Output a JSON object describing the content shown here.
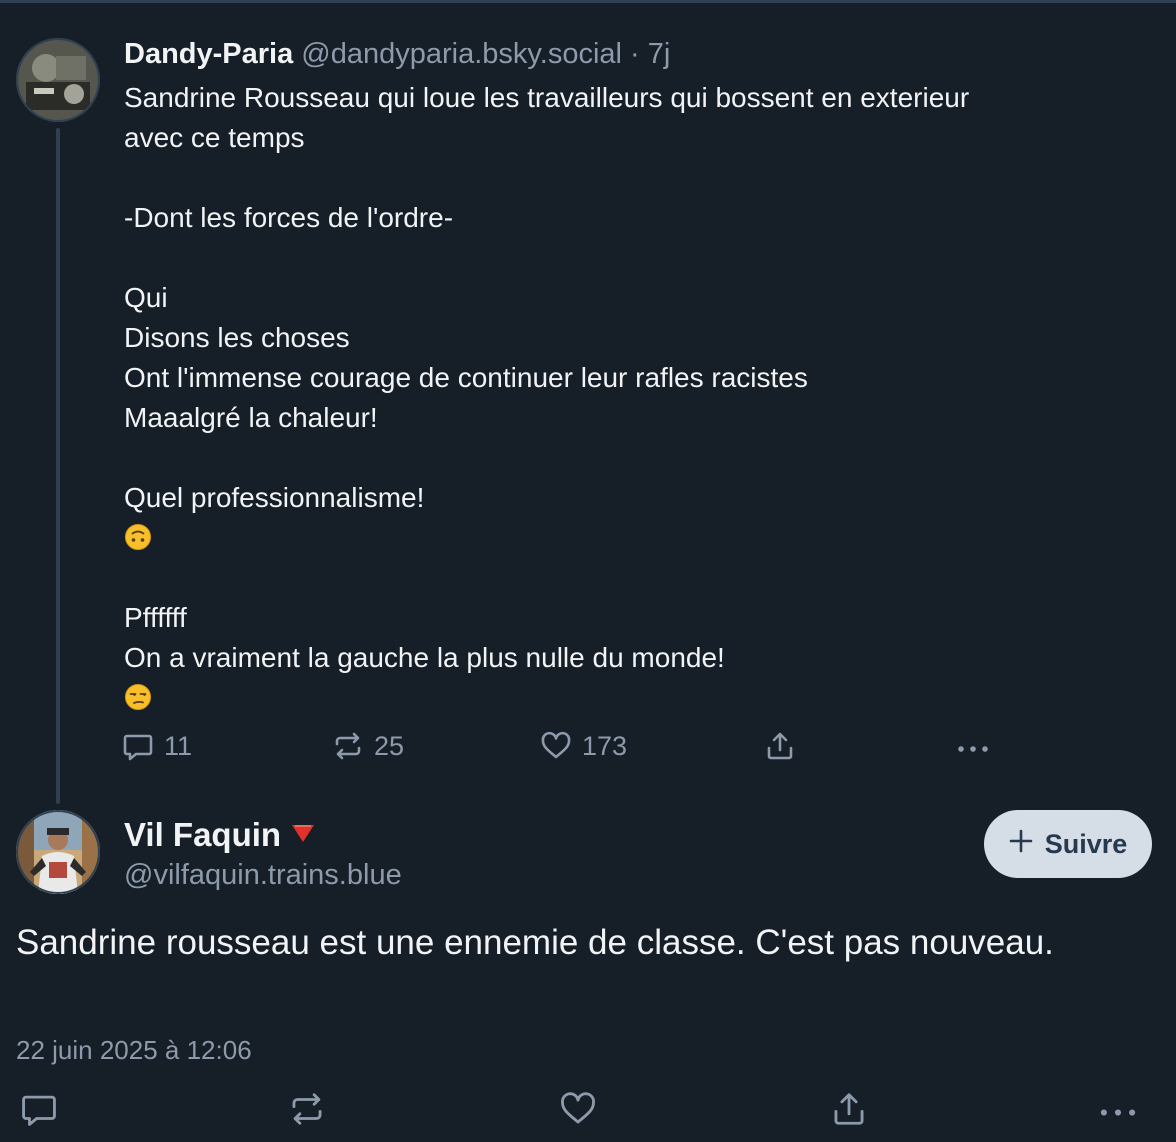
{
  "parent_post": {
    "author_name": "Dandy-Paria",
    "author_handle": "@dandyparia.bsky.social",
    "age": "· 7j",
    "text": "Sandrine Rousseau qui loue les travailleurs qui bossent en exterieur\navec ce temps\n\n-Dont les forces de l'ordre-\n\nQui\nDisons les choses\nOnt l'immense courage de continuer leur rafles racistes\nMaaalgré la chaleur!\n\nQuel professionnalisme!",
    "emoji_1": "upside-down-face-emoji",
    "text_2": "Pffffff\nOn a vraiment la gauche la plus nulle du monde!",
    "emoji_2": "unamused-face-emoji",
    "reply_count": "11",
    "repost_count": "25",
    "like_count": "173"
  },
  "main_post": {
    "author_name": "Vil Faquin",
    "author_badge": "red-triangle-down",
    "author_handle": "@vilfaquin.trains.blue",
    "follow_label": "Suivre",
    "text": "Sandrine rousseau est une ennemie de classe. C'est pas nouveau.",
    "timestamp": "22 juin 2025 à 12:06"
  },
  "icons": {
    "reply": "speech-bubble-icon",
    "repost": "repost-arrows-icon",
    "like": "heart-icon",
    "share": "share-upload-icon",
    "more": "more-dots-icon",
    "follow": "plus-icon"
  },
  "colors": {
    "background": "#161e27",
    "text": "#f1f3f5",
    "muted": "#8d9aab",
    "thread_line": "#2e4052",
    "follow_bg": "#d5dde6",
    "follow_text": "#27394e",
    "badge_red": "#e0322b"
  }
}
